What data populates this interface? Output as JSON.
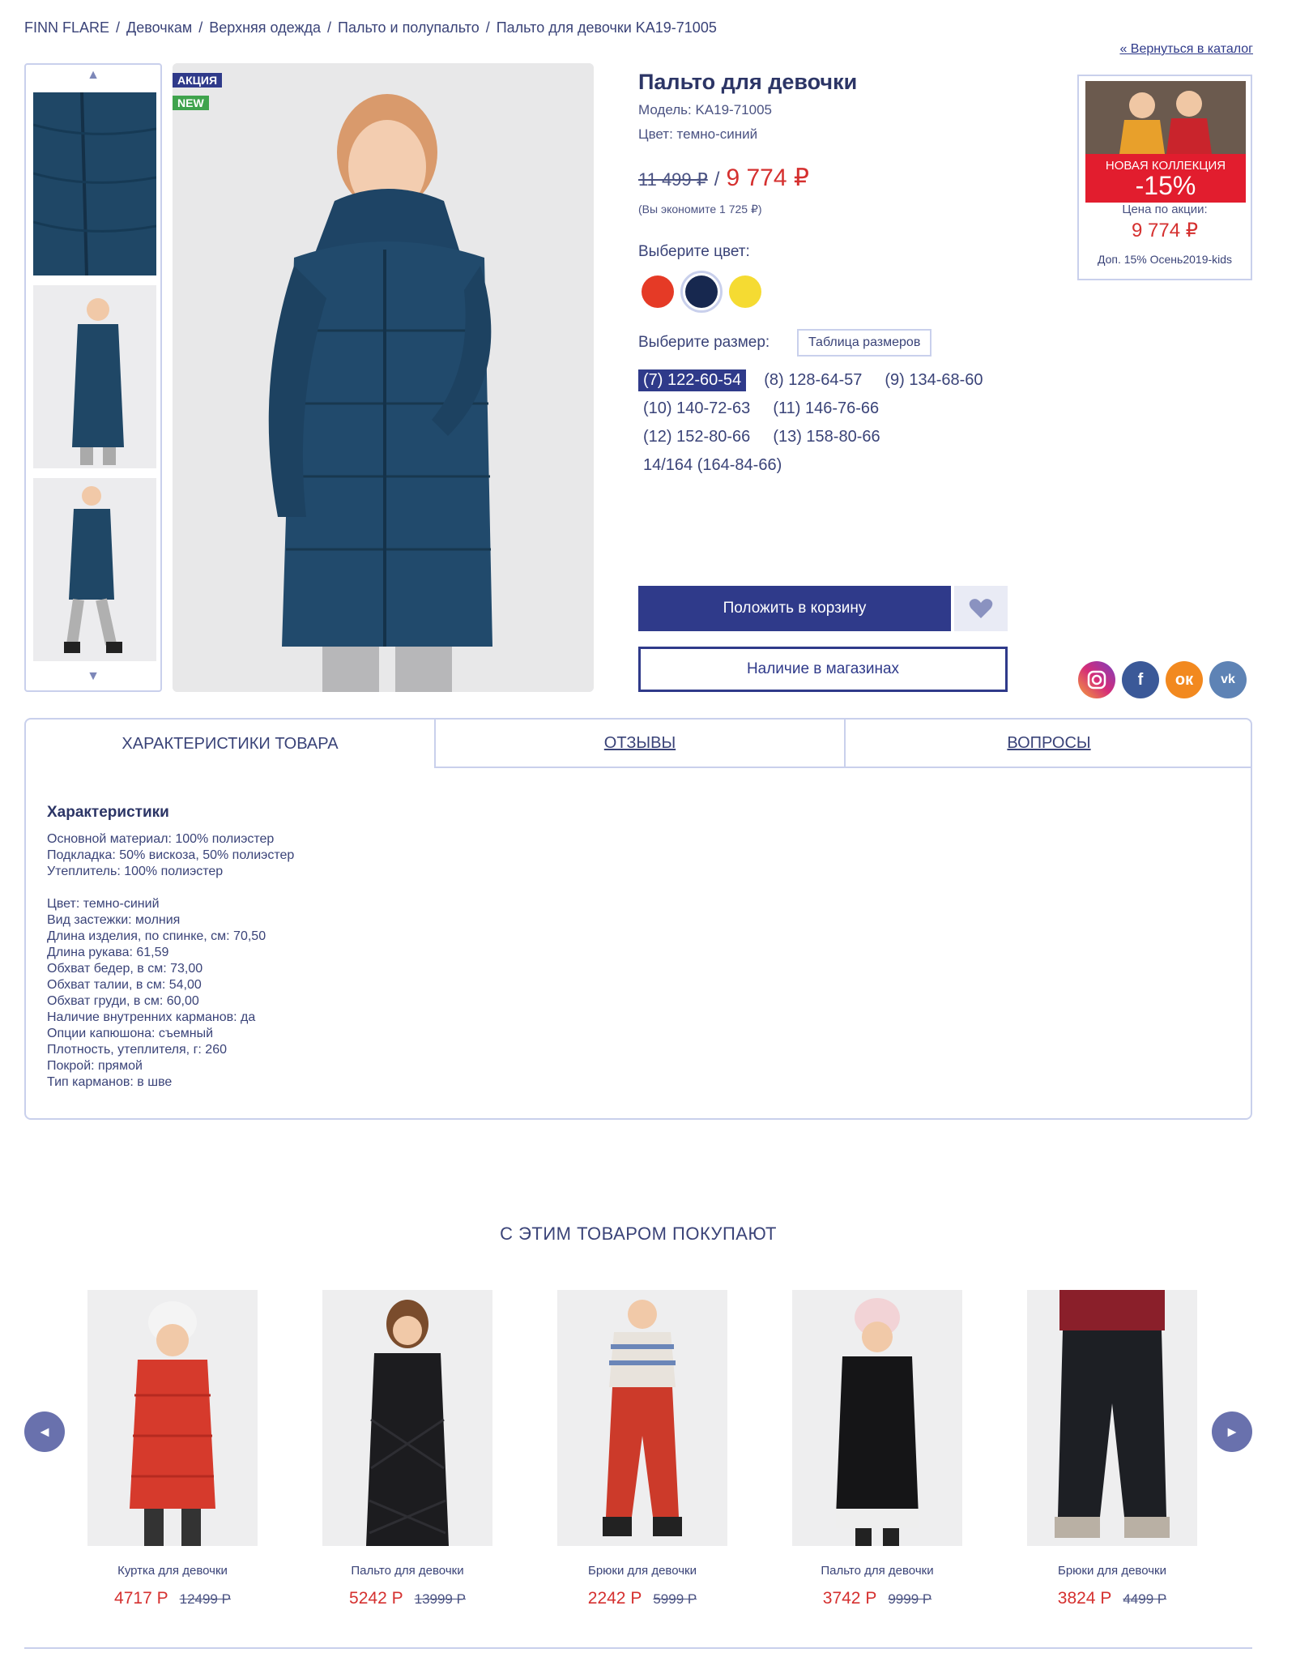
{
  "breadcrumb": [
    "FINN FLARE",
    "Девочкам",
    "Верхняя одежда",
    "Пальто и полупальто",
    "Пальто для девочки KA19-71005"
  ],
  "back_link": "« Вернуться в каталог",
  "badges": {
    "sale": "АКЦИЯ",
    "new": "NEW"
  },
  "product": {
    "title": "Пальто для девочки",
    "model": "Модель: KA19-71005",
    "color": "Цвет: темно-синий",
    "old_price": "11 499 ₽",
    "slash": "/",
    "new_price": "9 774 ₽",
    "saving": "(Вы экономите 1 725 ₽)",
    "choose_color": "Выберите цвет:",
    "colors": [
      "#e53a26",
      "#17284f",
      "#f5db32"
    ],
    "choose_size": "Выберите размер:",
    "size_table": "Таблица размеров",
    "sizes": [
      "(7) 122-60-54",
      "(8) 128-64-57",
      "(9) 134-68-60",
      "(10) 140-72-63",
      "(11) 146-76-66",
      "(12) 152-80-66",
      "(13) 158-80-66",
      "14/164 (164-84-66)"
    ],
    "cart_button": "Положить в корзину",
    "stores_button": "Наличие в магазинах"
  },
  "promo": {
    "line1": "НОВАЯ КОЛЛЕКЦИЯ",
    "line2": "-15%",
    "price_label": "Цена по акции:",
    "price": "9 774 ₽",
    "note": "Доп. 15% Осень2019-kids"
  },
  "socials": [
    "instagram-icon",
    "facebook-icon",
    "odnoklassniki-icon",
    "vk-icon"
  ],
  "tabs": [
    "ХАРАКТЕРИСТИКИ ТОВАРА",
    "ОТЗЫВЫ",
    "ВОПРОСЫ"
  ],
  "specs": {
    "heading": "Характеристики",
    "group1": [
      "Основной материал: 100% полиэстер",
      "Подкладка: 50% вискоза, 50% полиэстер",
      "Утеплитель: 100% полиэстер"
    ],
    "group2": [
      "Цвет: темно-синий",
      "Вид застежки: молния",
      "Длина изделия, по спинке, см: 70,50",
      "Длина рукава: 61,59",
      "Обхват бедер, в см: 73,00",
      "Обхват талии, в см: 54,00",
      "Обхват груди, в см: 60,00",
      "Наличие внутренних карманов: да",
      "Опции капюшона: съемный",
      "Плотность, утеплителя, г: 260",
      "Покрой: прямой",
      "Тип карманов: в шве"
    ]
  },
  "recommended": {
    "title": "С ЭТИМ ТОВАРОМ ПОКУПАЮТ",
    "items": [
      {
        "name": "Куртка для девочки",
        "price": "4717 Р",
        "old_price": "12499 Р"
      },
      {
        "name": "Пальто для девочки",
        "price": "5242 Р",
        "old_price": "13999 Р"
      },
      {
        "name": "Брюки для девочки",
        "price": "2242 Р",
        "old_price": "5999 Р"
      },
      {
        "name": "Пальто для девочки",
        "price": "3742 Р",
        "old_price": "9999 Р"
      },
      {
        "name": "Брюки для девочки",
        "price": "3824 Р",
        "old_price": "4499 Р"
      }
    ]
  },
  "colors": {
    "accent": "#2f3a8a",
    "price_red": "#d5302f",
    "border": "#c9d0ec"
  }
}
